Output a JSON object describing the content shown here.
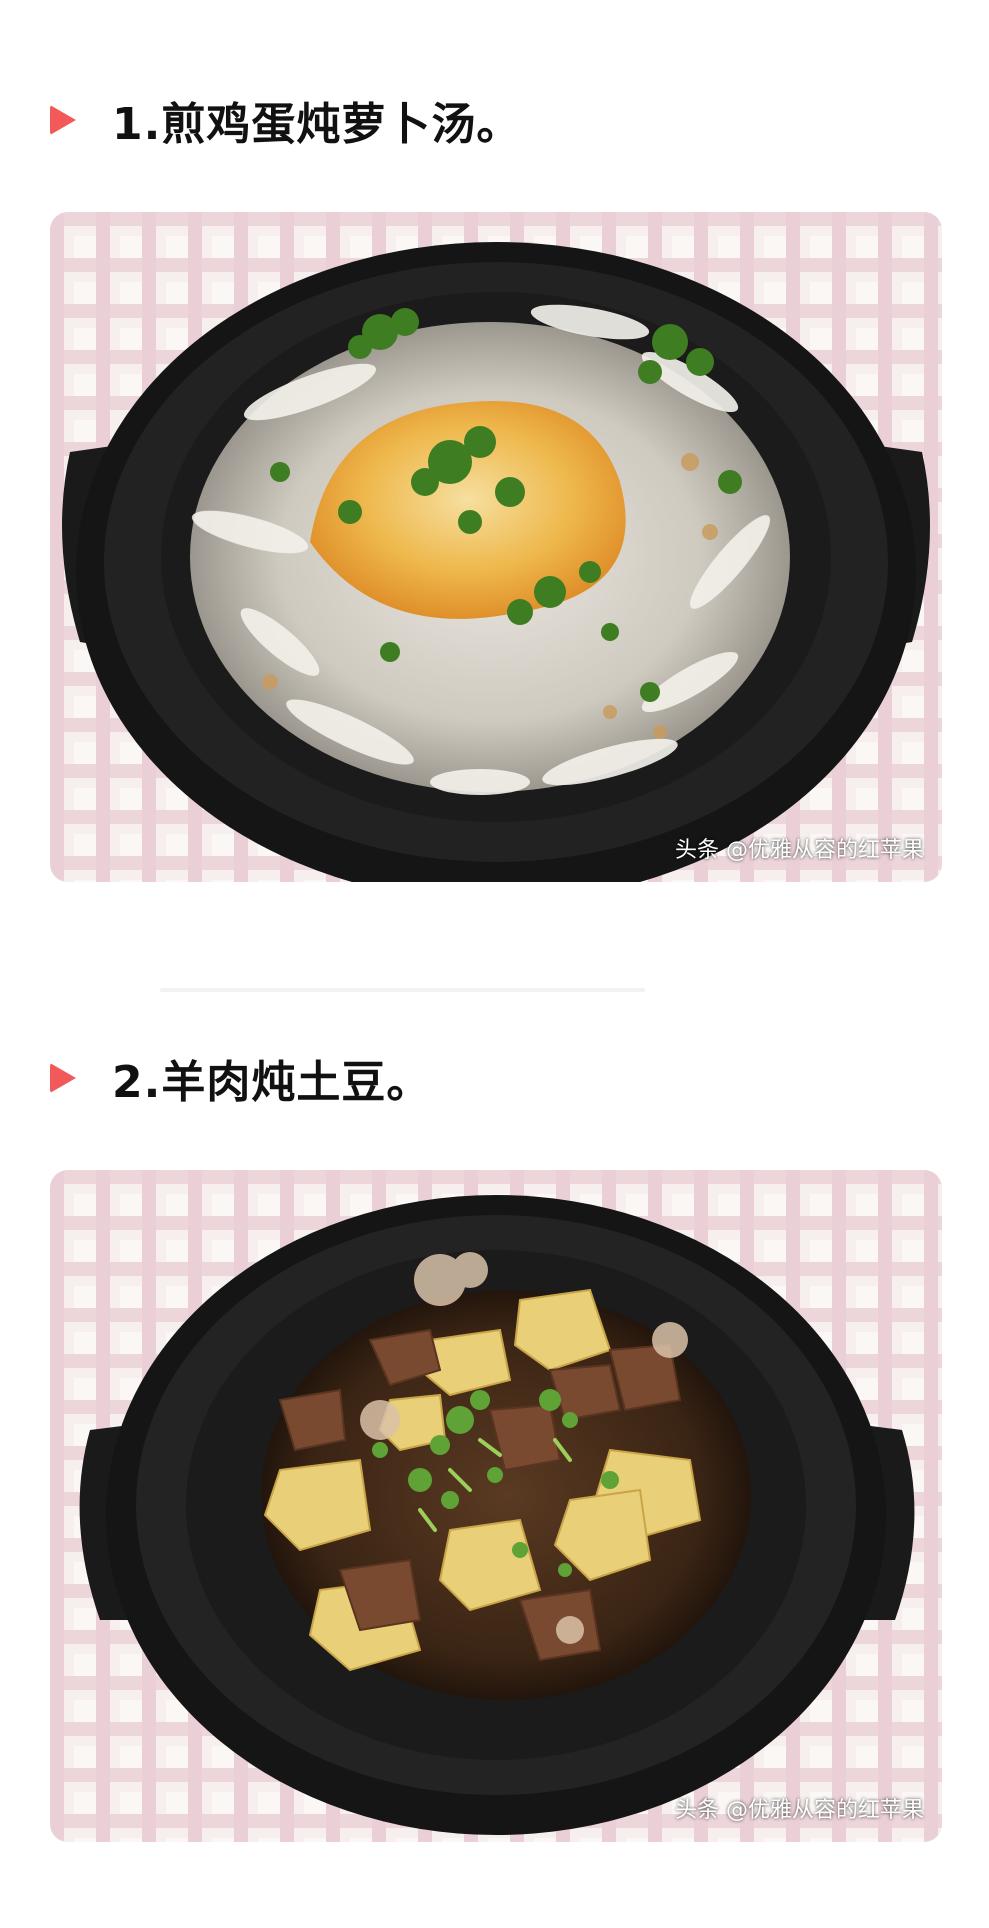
{
  "sections": [
    {
      "heading": "1.煎鸡蛋炖萝卜汤。",
      "image_alt": "煎鸡蛋炖萝卜汤",
      "watermark": "头条 @优雅从容的红苹果"
    },
    {
      "heading": "2.羊肉炖土豆。",
      "image_alt": "羊肉炖土豆",
      "watermark": "头条 @优雅从容的红苹果"
    }
  ],
  "colors": {
    "accent": "#f25a5a",
    "pot": "#1c1c1c",
    "tablecloth_line": "#e6c6cc"
  }
}
